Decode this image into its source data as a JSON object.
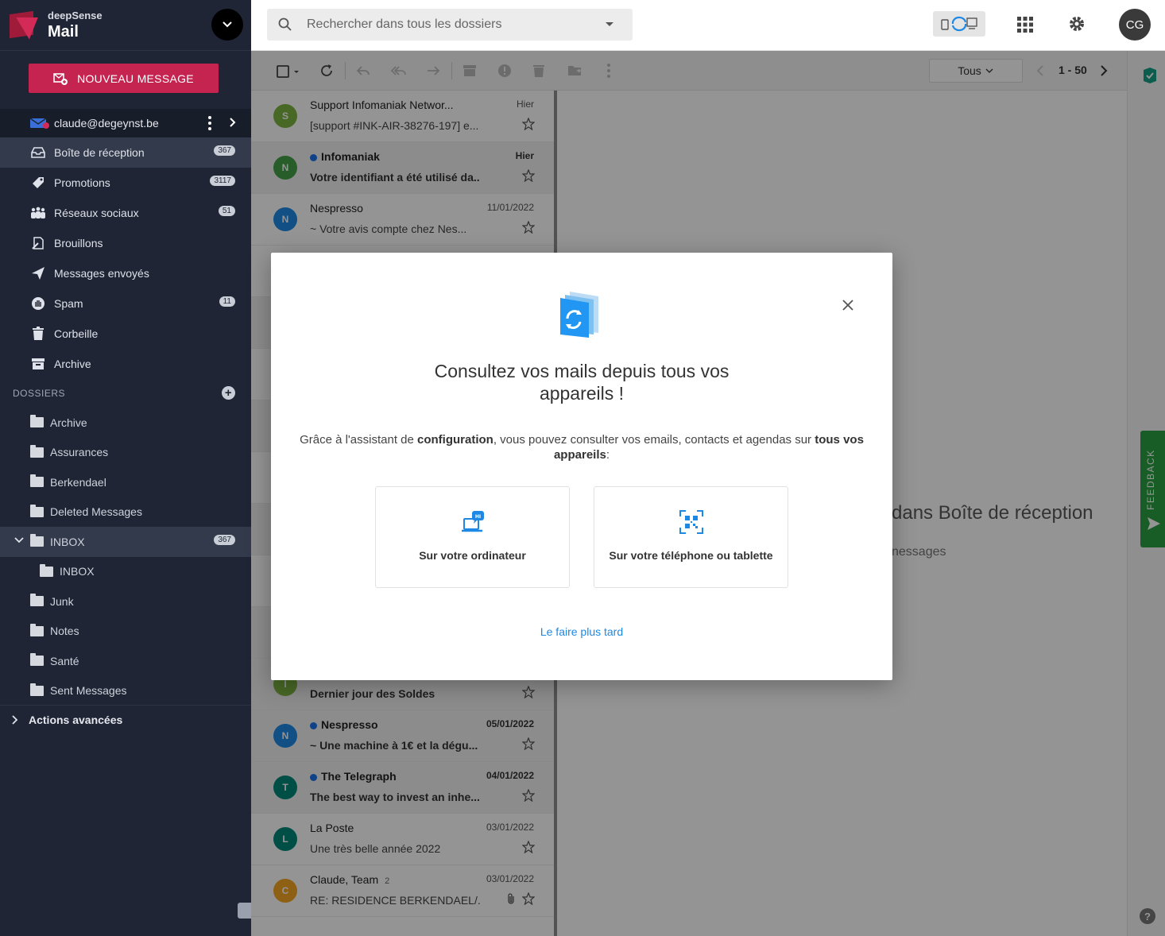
{
  "brand": {
    "company": "deepSense",
    "product": "Mail"
  },
  "sidebar": {
    "new_message": "NOUVEAU MESSAGE",
    "account": "claude@degeynst.be",
    "folders": [
      {
        "label": "Boîte de réception",
        "badge": "367"
      },
      {
        "label": "Promotions",
        "badge": "3117"
      },
      {
        "label": "Réseaux sociaux",
        "badge": "51"
      },
      {
        "label": "Brouillons",
        "badge": ""
      },
      {
        "label": "Messages envoyés",
        "badge": ""
      },
      {
        "label": "Spam",
        "badge": "11"
      },
      {
        "label": "Corbeille",
        "badge": ""
      },
      {
        "label": "Archive",
        "badge": ""
      }
    ],
    "dossiers_title": "DOSSIERS",
    "dossiers": [
      {
        "label": "Archive"
      },
      {
        "label": "Assurances"
      },
      {
        "label": "Berkendael"
      },
      {
        "label": "Deleted Messages"
      },
      {
        "label": "INBOX",
        "badge": "367"
      },
      {
        "label": "INBOX"
      },
      {
        "label": "Junk"
      },
      {
        "label": "Notes"
      },
      {
        "label": "Santé"
      },
      {
        "label": "Sent Messages"
      }
    ],
    "advanced": "Actions avancées"
  },
  "search": {
    "placeholder": "Rechercher dans tous les dossiers"
  },
  "user": {
    "initials": "CG"
  },
  "toolbar": {
    "filter": "Tous",
    "range": "1 - 50"
  },
  "messages": [
    {
      "initial": "S",
      "from": "Support Infomaniak Networ...",
      "date": "Hier",
      "subject": "[support #INK-AIR-38276-197] e...",
      "color": "#7cb342",
      "unread": false
    },
    {
      "initial": "N",
      "from": "Infomaniak",
      "date": "Hier",
      "subject": "Votre identifiant a été utilisé da...",
      "color": "#43a047",
      "unread": true
    },
    {
      "initial": "N",
      "from": "Nespresso",
      "date": "11/01/2022",
      "subject": "~ Votre avis compte chez Nes...",
      "color": "#1e88e5",
      "unread": false
    },
    {
      "initial": "I",
      "from": "",
      "date": "",
      "subject": "Dernier jour des Soldes",
      "color": "#7cb342",
      "unread": true
    },
    {
      "initial": "N",
      "from": "Nespresso",
      "date": "05/01/2022",
      "subject": "~ Une machine à 1€ et la dégu...",
      "color": "#1e88e5",
      "unread": true
    },
    {
      "initial": "T",
      "from": "The Telegraph",
      "date": "04/01/2022",
      "subject": "The best way to invest an inhe...",
      "color": "#00897b",
      "unread": true
    },
    {
      "initial": "L",
      "from": "La Poste",
      "date": "03/01/2022",
      "subject": "Une très belle année 2022",
      "color": "#00897b",
      "unread": false
    },
    {
      "initial": "C",
      "from": "Claude, Team",
      "count": "2",
      "date": "03/01/2022",
      "subject": "RE: RESIDENCE BERKENDAEL/...",
      "color": "#f5a623",
      "unread": false
    }
  ],
  "reading": {
    "empty_title_pre": "dans ",
    "empty_title_folder": "Boîte de réception",
    "empty_sub": "nessages"
  },
  "feedback": "FEEDBACK",
  "help": "?",
  "modal": {
    "title_line1": "Consultez vos mails depuis tous vos",
    "title_line2": "appareils !",
    "desc_pre": "Grâce à l'assistant de ",
    "desc_b1": "configuration",
    "desc_mid": ", vous pouvez consulter vos emails, contacts et agendas sur ",
    "desc_b2": "tous vos appareils",
    "desc_post": ":",
    "card_computer": "Sur votre ordinateur",
    "card_phone": "Sur votre téléphone ou tablette",
    "later": "Le faire plus tard",
    "accent": "#1e88e5"
  }
}
